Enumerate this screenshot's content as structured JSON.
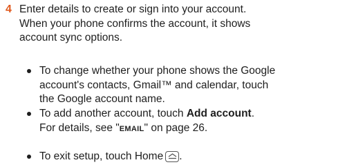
{
  "theme": {
    "accent": "#e05a1e"
  },
  "step": {
    "number": "4",
    "line1": "Enter details to create or sign into your account.",
    "line2": "When your phone confirms the account, it shows",
    "line3": "account sync options."
  },
  "bullets": [
    {
      "line1": "To change whether your phone shows the Google",
      "line2": "account's contacts, Gmail™ and calendar, touch",
      "line3": "the Google account name."
    },
    {
      "pre": "To add another account, touch ",
      "bold": "Add account",
      "post": ".",
      "line2_pre": "For details, see \"",
      "ref": "EMAIL",
      "line2_post": "\" on page 26."
    },
    {
      "text": "To exit setup, touch Home",
      "end": ".",
      "icon": "home-key-icon"
    }
  ]
}
